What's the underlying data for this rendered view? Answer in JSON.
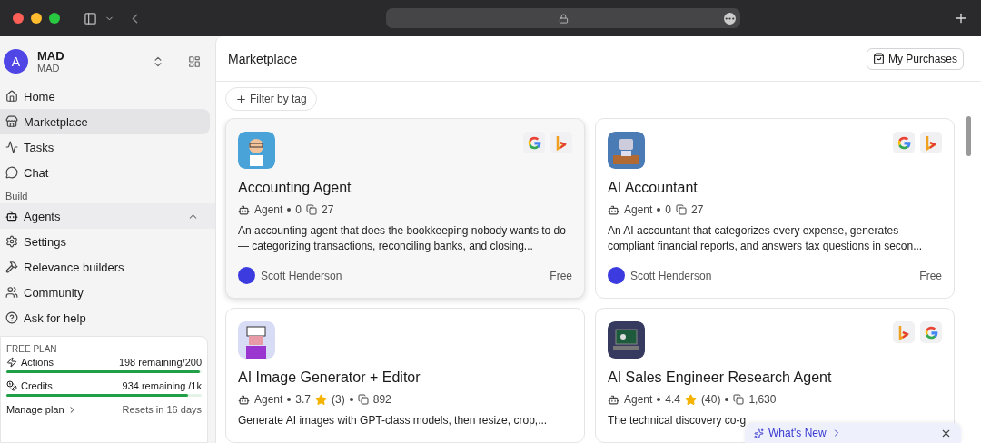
{
  "workspace": {
    "avatar": "A",
    "name": "MAD",
    "subtitle": "MAD"
  },
  "sidebar": {
    "items": [
      {
        "kind": "link",
        "label": "Home",
        "selected": false
      },
      {
        "kind": "link",
        "label": "Marketplace",
        "selected": true
      },
      {
        "kind": "link",
        "label": "Tasks",
        "selected": false
      },
      {
        "kind": "link",
        "label": "Chat",
        "selected": false
      },
      {
        "kind": "heading",
        "label": "Build"
      },
      {
        "kind": "group",
        "label": "Agents",
        "expanded": true
      },
      {
        "kind": "link",
        "label": "Settings",
        "selected": false
      },
      {
        "kind": "link",
        "label": "Relevance builders",
        "selected": false
      },
      {
        "kind": "link",
        "label": "Community",
        "selected": false
      },
      {
        "kind": "link",
        "label": "Ask for help",
        "selected": false
      }
    ]
  },
  "plan": {
    "title": "FREE PLAN",
    "meters": [
      {
        "name": "Actions",
        "reading": "198 remaining/200",
        "level": 0.99
      },
      {
        "name": "Credits",
        "reading": "934 remaining /1k",
        "level": 0.93
      }
    ],
    "manage_link": "Manage plan",
    "resets": "Resets in 16 days"
  },
  "header": {
    "title": "Marketplace",
    "purchases_button": "My Purchases"
  },
  "filter": {
    "label": "Filter by tag"
  },
  "cards": [
    {
      "selected": true,
      "title": "Accounting Agent",
      "type": "Agent",
      "rating": "0",
      "clones": "27",
      "description": "An accounting agent that does the bookkeeping nobody wants to do — categorizing transactions, reconciling banks, and closing...",
      "author": "Scott Henderson",
      "price": "Free",
      "tools": [
        {
          "kind": "google"
        },
        {
          "kind": "b"
        }
      ]
    },
    {
      "selected": false,
      "title": "AI Accountant",
      "type": "Agent",
      "rating": "0",
      "clones": "27",
      "description": "An AI accountant that categorizes every expense, generates compliant financial reports, and answers tax questions in secon...",
      "author": "Scott Henderson",
      "price": "Free",
      "tools": [
        {
          "kind": "google"
        },
        {
          "kind": "b"
        }
      ]
    },
    {
      "selected": false,
      "title": "AI Image Generator + Editor",
      "type": "Agent",
      "rating": "3.7",
      "reviews": "(3)",
      "clones": "892",
      "description": "Generate AI images with GPT-class models, then resize, crop,..."
    },
    {
      "selected": false,
      "title": "AI Sales Engineer Research Agent",
      "type": "Agent",
      "rating": "4.4",
      "reviews": "(40)",
      "clones": "1,630",
      "description": "The technical discovery co-g",
      "tools": [
        {
          "kind": "b"
        },
        {
          "kind": "google"
        }
      ]
    }
  ],
  "whats_new": {
    "label": "What's New"
  }
}
